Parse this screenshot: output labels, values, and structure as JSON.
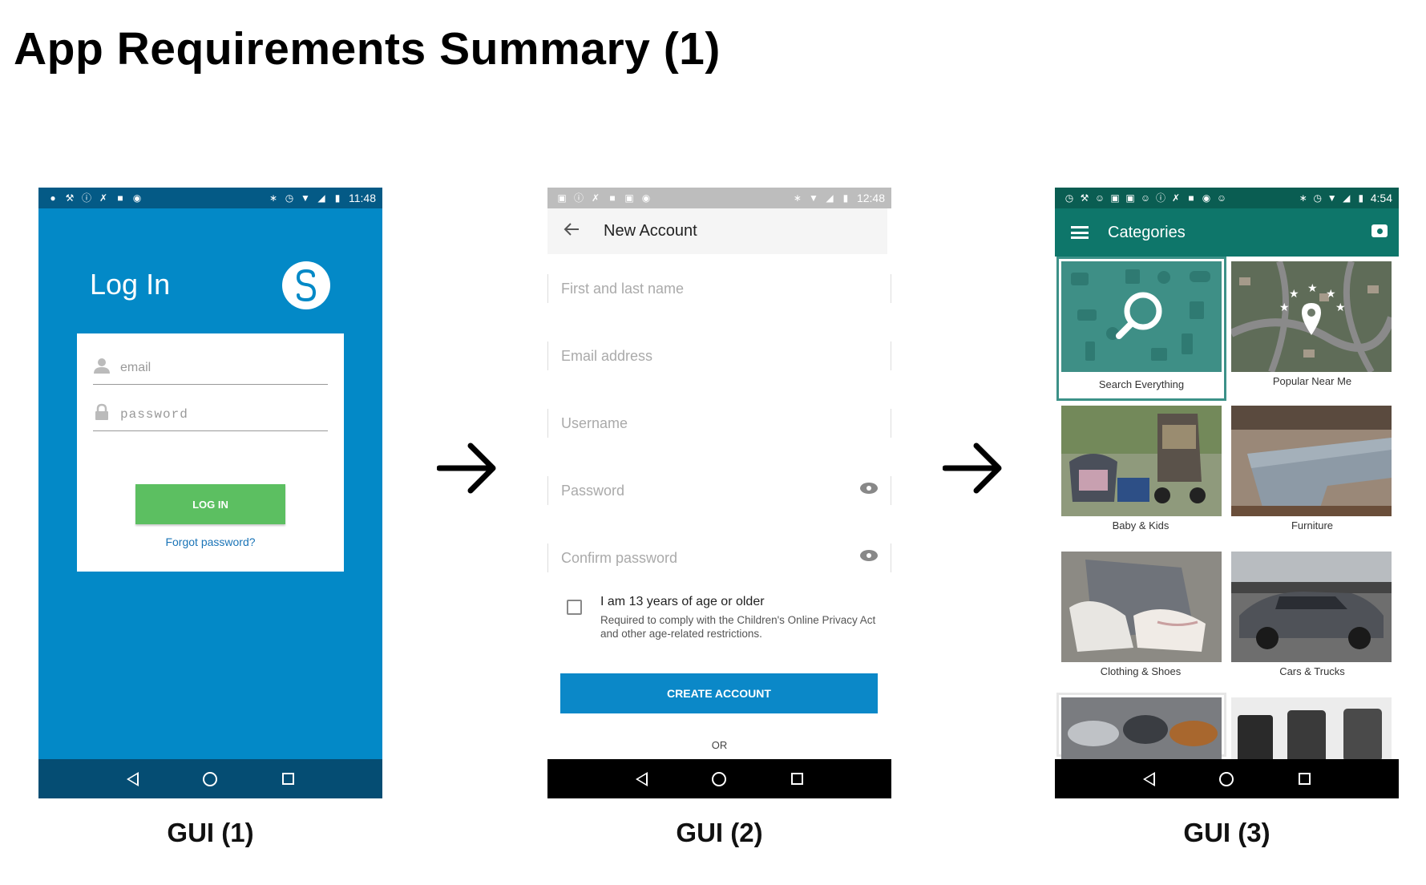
{
  "slide": {
    "title": "App Requirements Summary (1)",
    "arrow": "→"
  },
  "gui1": {
    "caption": "GUI (1)",
    "status_time": "11:48",
    "title": "Log In",
    "logo_letter": "S",
    "email_placeholder": "email",
    "password_placeholder": "password",
    "login_button": "LOG IN",
    "forgot_link": "Forgot password?",
    "colors": {
      "background": "#0389c7",
      "button": "#5cbf61",
      "statusbar": "#045a86"
    }
  },
  "gui2": {
    "caption": "GUI (2)",
    "status_time": "12:48",
    "title": "New Account",
    "fields": [
      "First and last name",
      "Email address",
      "Username",
      "Password",
      "Confirm password"
    ],
    "age_label": "I am 13 years of age or older",
    "age_sub": "Required to comply with the Children's Online Privacy Act and other age-related restrictions.",
    "create_button": "CREATE ACCOUNT",
    "or_text": "OR",
    "colors": {
      "button": "#0b88c8"
    }
  },
  "gui3": {
    "caption": "GUI (3)",
    "status_time": "4:54",
    "title": "Categories",
    "categories": [
      "Search Everything",
      "Popular Near Me",
      "Baby & Kids",
      "Furniture",
      "Clothing & Shoes",
      "Cars & Trucks"
    ],
    "colors": {
      "appbar": "#0e766a"
    }
  }
}
